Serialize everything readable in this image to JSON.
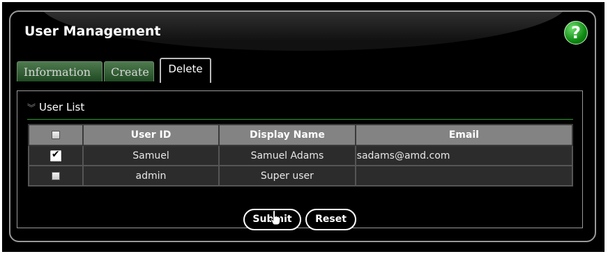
{
  "header": {
    "title": "User Management",
    "help_label": "?"
  },
  "tabs": [
    {
      "label": "Information",
      "active": false
    },
    {
      "label": "Create",
      "active": false
    },
    {
      "label": "Delete",
      "active": true
    }
  ],
  "section": {
    "title": "User List",
    "chevron_icon": "double-chevron-down-icon"
  },
  "table": {
    "columns": [
      "User ID",
      "Display Name",
      "Email"
    ],
    "rows": [
      {
        "checked": true,
        "user_id": "Samuel",
        "display_name": "Samuel Adams",
        "email": "sadams@amd.com"
      },
      {
        "checked": false,
        "user_id": "admin",
        "display_name": "Super user",
        "email": ""
      }
    ]
  },
  "buttons": {
    "submit": "Submit",
    "reset": "Reset"
  },
  "colors": {
    "tab_green": "#2f5e31",
    "accent_green": "#1a9a1e",
    "header_gray": "#838383"
  }
}
